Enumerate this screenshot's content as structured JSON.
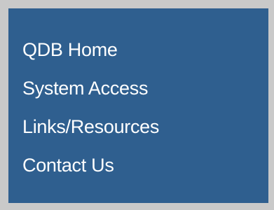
{
  "nav": {
    "items": [
      {
        "label": "QDB Home"
      },
      {
        "label": "System Access"
      },
      {
        "label": "Links/Resources"
      },
      {
        "label": "Contact Us"
      }
    ]
  },
  "colors": {
    "panel_background": "#2f5f8f",
    "frame_gray": "#c9c9c9",
    "link_text": "#ffffff"
  }
}
